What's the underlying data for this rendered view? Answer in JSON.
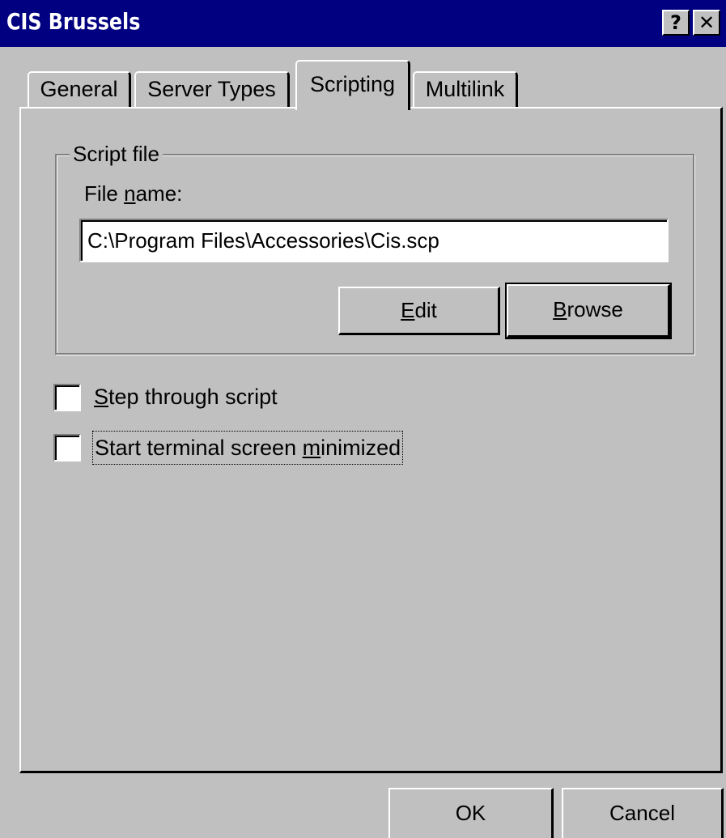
{
  "window": {
    "title": "CIS Brussels",
    "help_button": "?",
    "close_button": "✕"
  },
  "tabs": [
    {
      "label": "General",
      "active": false
    },
    {
      "label": "Server Types",
      "active": false
    },
    {
      "label": "Scripting",
      "active": true
    },
    {
      "label": "Multilink",
      "active": false
    }
  ],
  "script_file": {
    "group_label": "Script file",
    "file_name_label_pre": "File ",
    "file_name_label_accel": "n",
    "file_name_label_post": "ame:",
    "file_name_value": "C:\\Program Files\\Accessories\\Cis.scp",
    "edit_accel": "E",
    "edit_rest": "dit",
    "browse_accel": "B",
    "browse_rest": "rowse"
  },
  "options": {
    "step_through_accel": "S",
    "step_through_rest": "tep through script",
    "step_through_checked": false,
    "start_minimized_pre": "Start terminal screen ",
    "start_minimized_accel": "m",
    "start_minimized_post": "inimized",
    "start_minimized_checked": false
  },
  "footer": {
    "ok_label": "OK",
    "cancel_label": "Cancel"
  },
  "colors": {
    "titlebar": "#000080",
    "face": "#c0c0c0"
  }
}
